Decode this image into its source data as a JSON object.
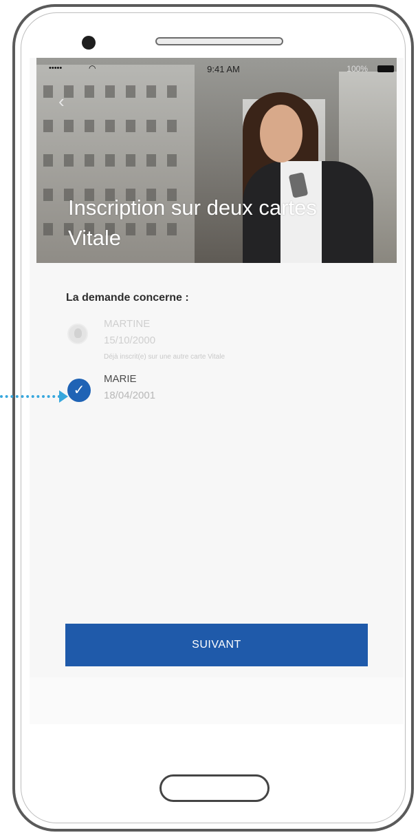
{
  "status_bar": {
    "signal": "•••••",
    "time": "9:41 AM",
    "battery": "100%"
  },
  "header": {
    "title": "Inscription sur deux cartes Vitale"
  },
  "content": {
    "question": "La demande concerne :",
    "people": [
      {
        "name": "MARTINE",
        "date": "15/10/2000",
        "note": "Déjà inscrit(e) sur une autre carte Vitale",
        "selected": false
      },
      {
        "name": "MARIE",
        "date": "18/04/2001",
        "note": "",
        "selected": true
      }
    ]
  },
  "actions": {
    "next_label": "SUIVANT"
  },
  "colors": {
    "primary": "#1f5aaa",
    "check": "#1f63b5",
    "pointer": "#37a7dd"
  },
  "icons": {
    "back": "chevron-left-icon",
    "check": "check-icon",
    "avatar": "person-avatar-icon"
  }
}
